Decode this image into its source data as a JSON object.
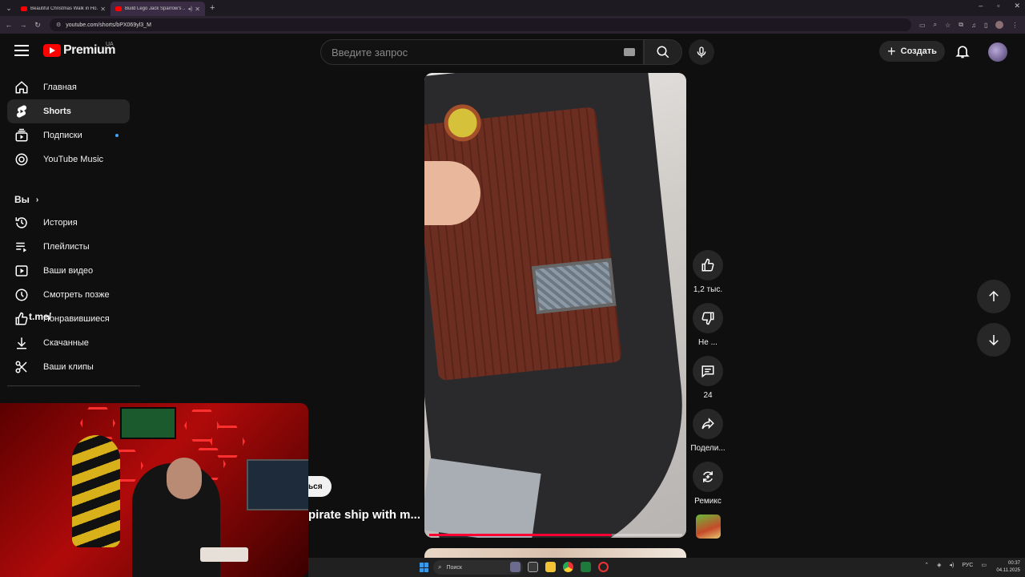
{
  "browser": {
    "tabs": [
      {
        "title": "Beautiful Christmas Walk in Ho...",
        "active": false
      },
      {
        "title": "Build Lego Jack Sparrow's ...",
        "active": true
      }
    ],
    "url": "youtube.com/shorts/bPX069yl3_M"
  },
  "header": {
    "logo": "Premium",
    "country": "UA",
    "search_placeholder": "Введите запрос",
    "create_label": "Создать"
  },
  "sidebar": {
    "items": [
      {
        "label": "Главная",
        "icon": "home-icon"
      },
      {
        "label": "Shorts",
        "icon": "shorts-icon"
      },
      {
        "label": "Подписки",
        "icon": "subscriptions-icon"
      },
      {
        "label": "YouTube Music",
        "icon": "music-icon"
      }
    ],
    "you_label": "Вы",
    "you_items": [
      {
        "label": "История",
        "icon": "history-icon"
      },
      {
        "label": "Плейлисты",
        "icon": "playlists-icon"
      },
      {
        "label": "Ваши видео",
        "icon": "your-videos-icon"
      },
      {
        "label": "Смотреть позже",
        "icon": "watch-later-icon"
      },
      {
        "label": "Понравившиеся",
        "icon": "liked-icon"
      },
      {
        "label": "Скачанные",
        "icon": "downloads-icon"
      },
      {
        "label": "Ваши клипы",
        "icon": "clips-icon"
      }
    ],
    "watermark": "t.me/"
  },
  "short": {
    "title": "pirate ship with m...",
    "subscribe_label": "ься",
    "progress": 0.72
  },
  "actions": {
    "like_count": "1,2 тыс.",
    "dislike_label": "Не ...",
    "comments_count": "24",
    "share_label": "Подели...",
    "remix_label": "Ремикс"
  },
  "taskbar": {
    "search_placeholder": "Поиск",
    "lang": "РУС",
    "time": "00:37",
    "date": "04.11.2025"
  },
  "colors": {
    "background": "#0f0f0f",
    "accent": "#ff0000",
    "progress": "#ff0033",
    "notification_dot": "#3ea6ff"
  }
}
